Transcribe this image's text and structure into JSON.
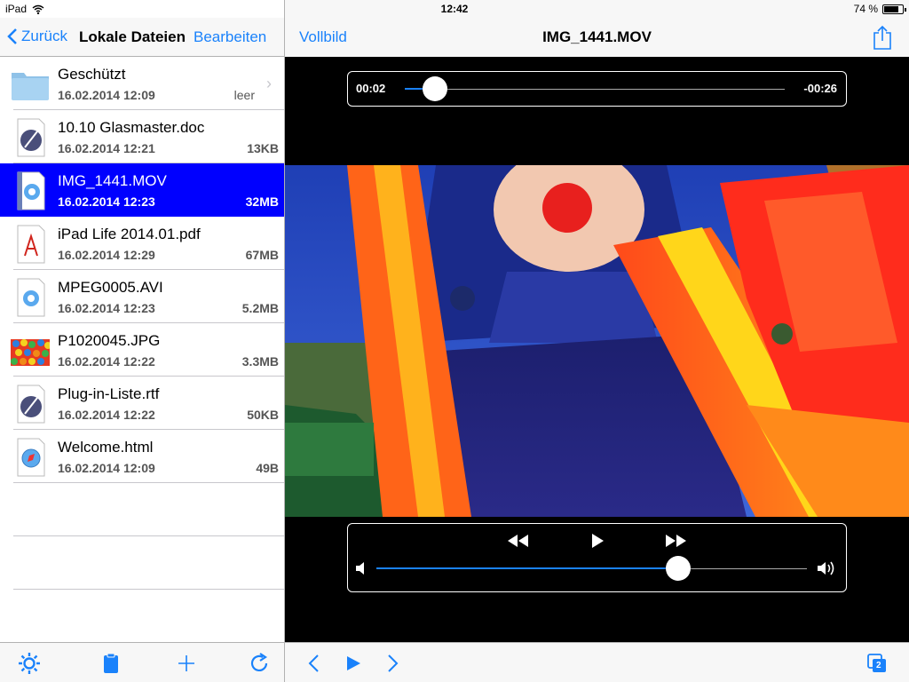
{
  "status": {
    "device": "iPad",
    "time": "12:42",
    "battery": "74 %",
    "battery_level": 0.74
  },
  "left_nav": {
    "back_label": "Zurück",
    "title": "Lokale Dateien",
    "edit_label": "Bearbeiten"
  },
  "files": [
    {
      "name": "Geschützt",
      "date": "16.02.2014 12:09",
      "size": "leer",
      "type": "folder"
    },
    {
      "name": "10.10 Glasmaster.doc",
      "date": "16.02.2014 12:21",
      "size": "13KB",
      "type": "doc"
    },
    {
      "name": "IMG_1441.MOV",
      "date": "16.02.2014 12:23",
      "size": "32MB",
      "type": "video",
      "selected": true
    },
    {
      "name": "iPad Life 2014.01.pdf",
      "date": "16.02.2014 12:29",
      "size": "67MB",
      "type": "pdf"
    },
    {
      "name": "MPEG0005.AVI",
      "date": "16.02.2014 12:23",
      "size": "5.2MB",
      "type": "video"
    },
    {
      "name": "P1020045.JPG",
      "date": "16.02.2014 12:22",
      "size": "3.3MB",
      "type": "image"
    },
    {
      "name": "Plug-in-Liste.rtf",
      "date": "16.02.2014 12:22",
      "size": "50KB",
      "type": "doc"
    },
    {
      "name": "Welcome.html",
      "date": "16.02.2014 12:09",
      "size": "49B",
      "type": "html"
    }
  ],
  "left_toolbar": {
    "icons": [
      "gear-icon",
      "clipboard-icon",
      "plus-icon",
      "refresh-icon"
    ]
  },
  "right_nav": {
    "fullscreen_label": "Vollbild",
    "title": "IMG_1441.MOV",
    "share_icon": "share-icon"
  },
  "player": {
    "elapsed": "00:02",
    "remaining": "-00:26",
    "position": 0.08,
    "volume": 0.7,
    "controls": [
      "rewind-icon",
      "play-icon",
      "fast-forward-icon"
    ]
  },
  "right_toolbar": {
    "icons": [
      "previous-icon",
      "play-icon",
      "next-icon",
      "windows-icon"
    ],
    "windows_count": "2"
  },
  "colors": {
    "accent": "#1a82fb",
    "selection": "#0000ff"
  }
}
